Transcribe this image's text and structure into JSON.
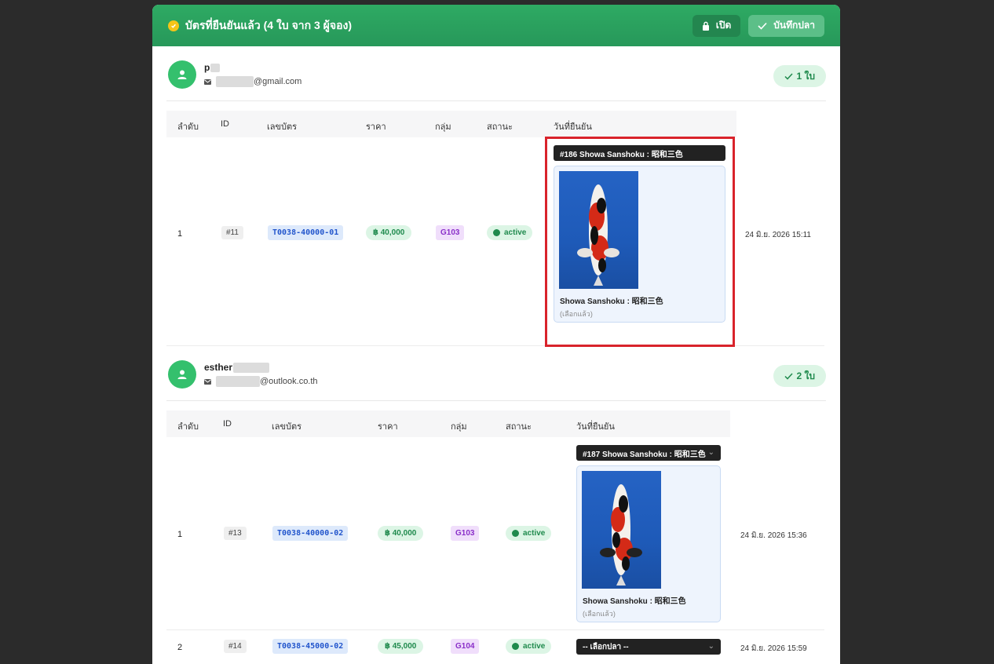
{
  "header": {
    "title": "บัตรที่ยืนยันแล้ว (4 ใบ จาก 3 ผู้จอง)",
    "lock_label": "เปิด",
    "save_label": "บันทึกปลา"
  },
  "columns": [
    "ลำดับ",
    "ID",
    "เลขบัตร",
    "ราคา",
    "กลุ่ม",
    "สถานะ",
    "วันที่ยืนยัน"
  ],
  "users": [
    {
      "name": "p",
      "email": "@gmail.com",
      "count": "1 ใบ",
      "rows": [
        {
          "no": "1",
          "id": "#11",
          "card": "T0038-40000-01",
          "price": "฿ 40,000",
          "group": "G103",
          "status": "active",
          "fish_select": "#186 Showa Sanshoku : 昭和三色",
          "fish_name": "Showa Sanshoku : 昭和三色",
          "fish_note": "(เลือกแล้ว)",
          "date": "24 มิ.ย. 2026 15:11"
        }
      ]
    },
    {
      "name": "esther",
      "email": "@outlook.co.th",
      "count": "2 ใบ",
      "rows": [
        {
          "no": "1",
          "id": "#13",
          "card": "T0038-40000-02",
          "price": "฿ 40,000",
          "group": "G103",
          "status": "active",
          "fish_select": "#187 Showa Sanshoku : 昭和三色",
          "fish_name": "Showa Sanshoku : 昭和三色",
          "fish_note": "(เลือกแล้ว)",
          "date": "24 มิ.ย. 2026 15:36"
        },
        {
          "no": "2",
          "id": "#14",
          "card": "T0038-45000-02",
          "price": "฿ 45,000",
          "group": "G104",
          "status": "active",
          "fish_select": "-- เลือกปลา --",
          "date": "24 มิ.ย. 2026 15:59"
        }
      ]
    }
  ],
  "colors": {
    "header": "#2eaa63",
    "highlight": "#d9232b",
    "accent_green": "#1f8a4d"
  }
}
